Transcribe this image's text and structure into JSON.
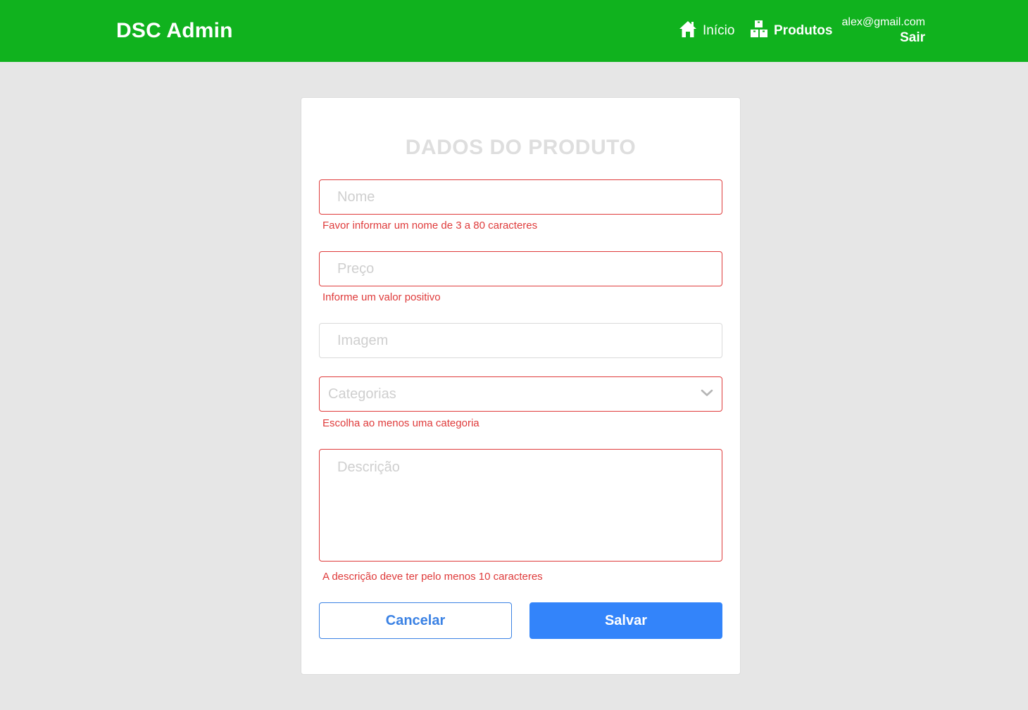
{
  "navbar": {
    "brand": "DSC Admin",
    "links": [
      {
        "label": "Início",
        "icon": "home-icon"
      },
      {
        "label": "Produtos",
        "icon": "boxes-icon"
      }
    ],
    "user_email": "alex@gmail.com",
    "logout_label": "Sair",
    "background_color": "#10b21e"
  },
  "form": {
    "title": "DADOS DO PRODUTO",
    "name": {
      "placeholder": "Nome",
      "value": "",
      "error": "Favor informar um nome de 3 a 80 caracteres"
    },
    "price": {
      "placeholder": "Preço",
      "value": "",
      "error": "Informe um valor positivo"
    },
    "image": {
      "placeholder": "Imagem",
      "value": ""
    },
    "categories": {
      "placeholder": "Categorias",
      "error": "Escolha ao menos uma categoria"
    },
    "description": {
      "placeholder": "Descrição",
      "value": "",
      "error": "A descrição deve ter pelo menos 10 caracteres"
    },
    "cancel_label": "Cancelar",
    "save_label": "Salvar",
    "error_color": "#df3b3b",
    "primary_color": "#3384fa"
  }
}
